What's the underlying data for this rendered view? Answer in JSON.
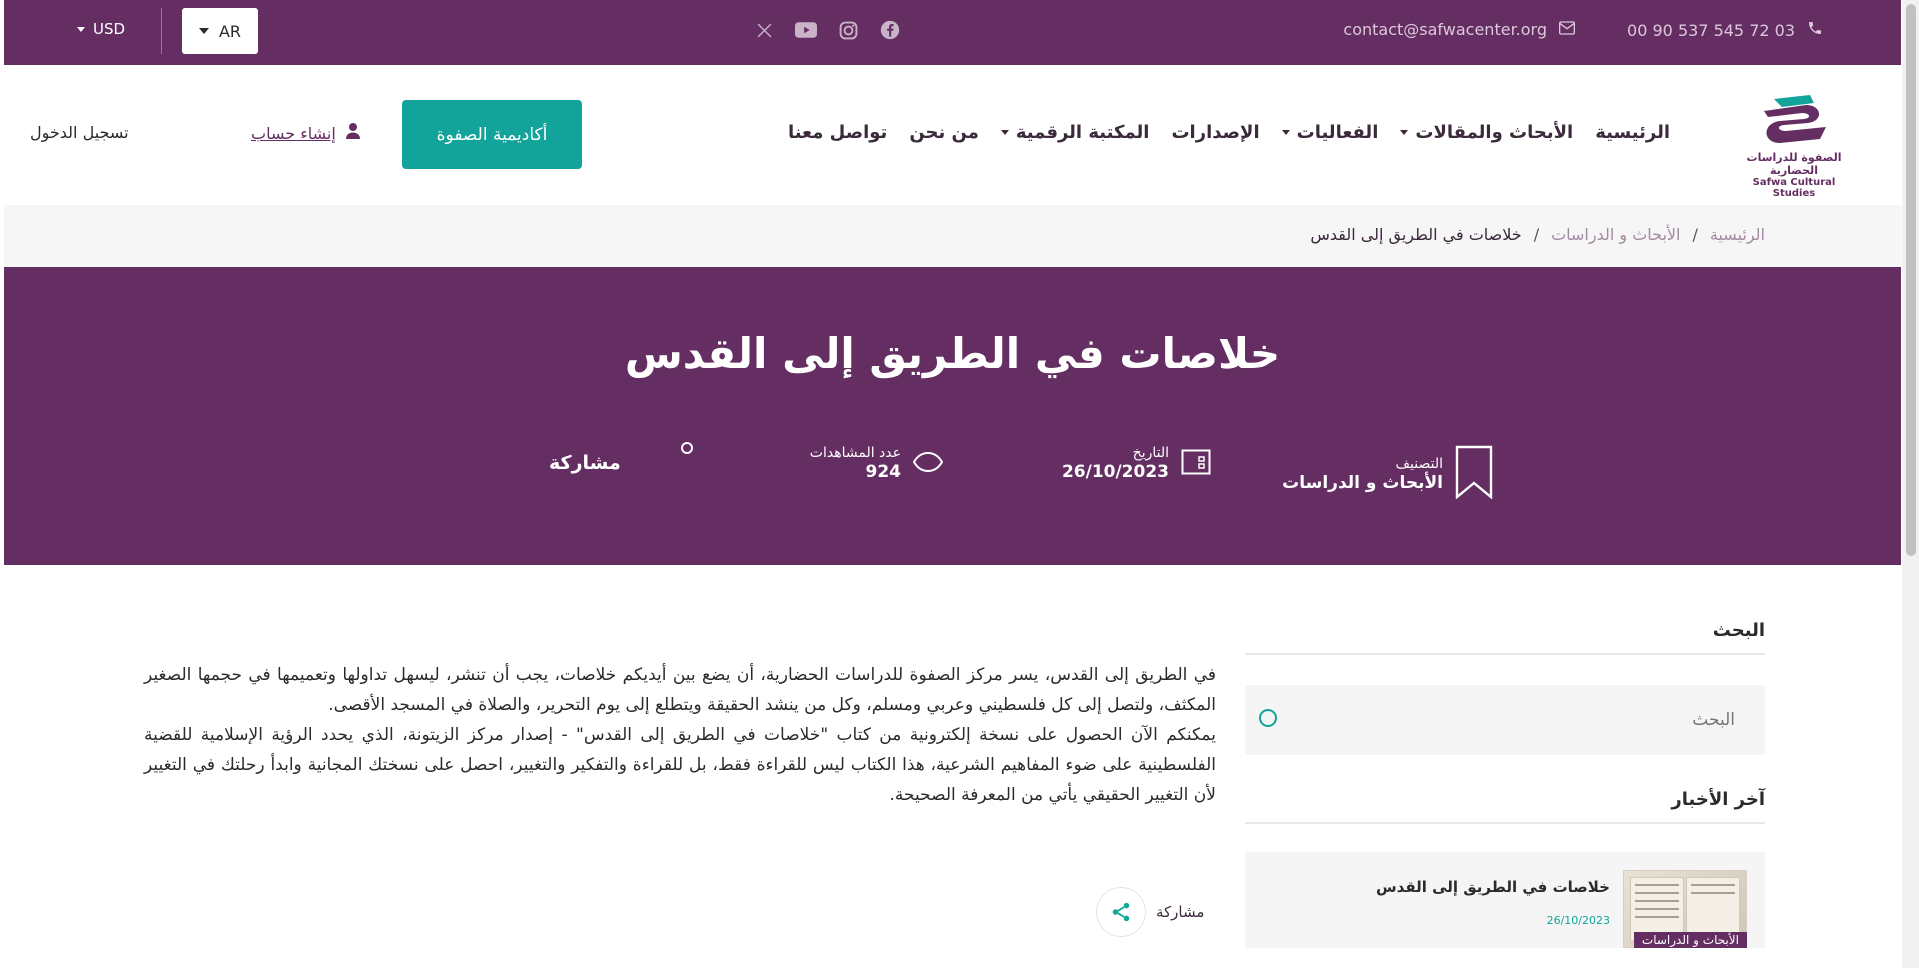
{
  "topbar": {
    "phone": "00 90 537 545 72 03",
    "email": "contact@safwacenter.org",
    "socials": [
      "x-icon",
      "youtube-icon",
      "instagram-icon",
      "facebook-icon"
    ],
    "language": "AR",
    "currency": "USD"
  },
  "header": {
    "logo_ar": "الصفوة للدراسات الحضارية",
    "logo_en": "Safwa Cultural Studies",
    "nav": [
      {
        "label": "الرئيسية",
        "dropdown": false
      },
      {
        "label": "الأبحاث والمقالات",
        "dropdown": true
      },
      {
        "label": "الفعاليات",
        "dropdown": true
      },
      {
        "label": "الإصدارات",
        "dropdown": false
      },
      {
        "label": "المكتبة الرقمية",
        "dropdown": true
      },
      {
        "label": "من نحن",
        "dropdown": false
      },
      {
        "label": "تواصل معنا",
        "dropdown": false
      }
    ],
    "academy_button": "أكاديمية الصفوة",
    "register_link": "إنشاء حساب",
    "login_link": "تسجيل الدخول"
  },
  "breadcrumb": {
    "items": [
      "الرئيسية",
      "الأبحاث و الدراسات",
      "خلاصات في الطريق إلى القدس"
    ],
    "separator": "/"
  },
  "hero": {
    "title": "خلاصات في الطريق إلى القدس",
    "category_label": "التصنيف",
    "category_value": "الأبحاث و الدراسات",
    "date_label": "التاريخ",
    "date_value": "26/10/2023",
    "views_label": "عدد المشاهدات",
    "views_value": "924",
    "share_label": "مشاركة"
  },
  "article": {
    "paragraph1": "في الطريق إلى القدس، يسر مركز الصفوة للدراسات الحضارية، أن يضع بين أيديكم خلاصات، يجب أن تنشر، ليسهل تداولها وتعميمها في حجمها الصغير المكثف، ولتصل إلى كل فلسطيني وعربي ومسلم، وكل من ينشد الحقيقة ويتطلع إلى يوم التحرير، والصلاة في المسجد الأقصى.",
    "paragraph2": "يمكنكم الآن الحصول على نسخة إلكترونية من كتاب \"خلاصات في الطريق إلى القدس\" - إصدار مركز الزيتونة، الذي يحدد الرؤية الإسلامية للقضية الفلسطينية على ضوء المفاهيم الشرعية، هذا الكتاب ليس للقراءة فقط، بل للقراءة والتفكير والتغيير، احصل على نسختك المجانية وابدأ رحلتك في التغيير لأن التغيير الحقيقي يأتي من المعرفة الصحيحة.",
    "share_label": "مشاركة"
  },
  "sidebar": {
    "search_title": "البحث",
    "search_placeholder": "البحث",
    "news_title": "آخر الأخبار",
    "news": [
      {
        "title": "خلاصات في الطريق إلى القدس",
        "date": "26/10/2023",
        "category": "الأبحاث و الدراسات"
      }
    ]
  },
  "colors": {
    "brand_purple": "#652e63",
    "accent_teal": "#12a39a"
  }
}
